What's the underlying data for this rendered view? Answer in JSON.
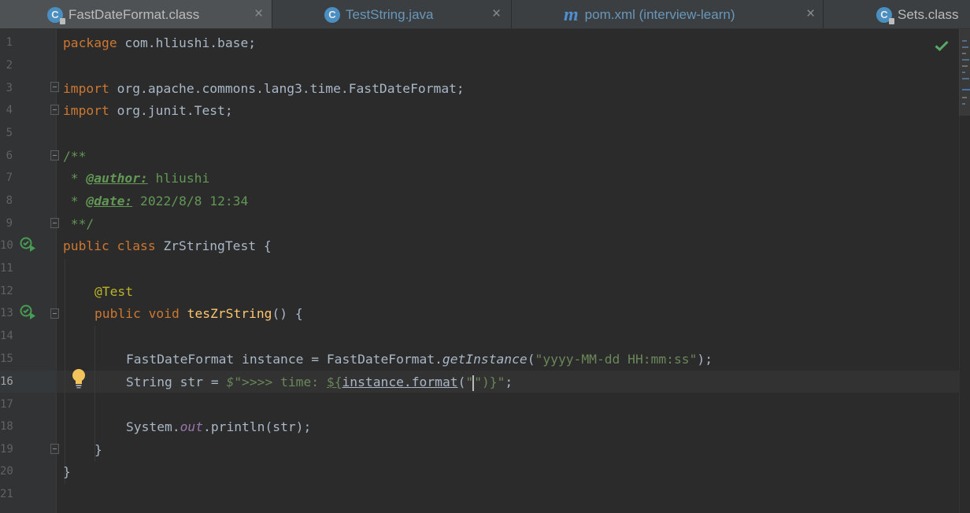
{
  "tabs": [
    {
      "name": "tab-fastdateformat-class",
      "label": "FastDateFormat.class",
      "icon": "class-file-icon",
      "icon_letter": "C",
      "active": true,
      "close": "×"
    },
    {
      "name": "tab-teststring-java",
      "label": "TestString.java",
      "icon": "java-class-icon",
      "icon_letter": "C",
      "active": false,
      "close": "×"
    },
    {
      "name": "tab-pom-xml",
      "label": "pom.xml (interview-learn)",
      "icon": "maven-icon",
      "icon_letter": "m",
      "active": false,
      "close": "×"
    },
    {
      "name": "tab-sets-class",
      "label": "Sets.class",
      "icon": "class-file-icon",
      "icon_letter": "C",
      "active": false,
      "close": ""
    }
  ],
  "colors": {
    "editor_bg": "#2b2b2b",
    "keyword": "#cc7832",
    "string": "#6a8759",
    "doc": "#629755",
    "annotation": "#bbb529",
    "method": "#ffc66d",
    "field": "#9876aa",
    "text": "#a9b7c6",
    "tab_text": "#a9b7c6",
    "tab_text_modified": "#6897bb"
  },
  "editor": {
    "caret_line": 16,
    "line_numbers": [
      "1",
      "2",
      "3",
      "4",
      "5",
      "6",
      "7",
      "8",
      "9",
      "10",
      "11",
      "12",
      "13",
      "14",
      "15",
      "16",
      "17",
      "18",
      "19",
      "20",
      "21"
    ],
    "code": {
      "l1_kw": "package",
      "l1_rest": " com.hliushi.base;",
      "l3_kw": "import",
      "l3_rest": " org.apache.commons.lang3.time.FastDateFormat;",
      "l4_kw": "import",
      "l4_rest": " org.junit.Test;",
      "l6": "/**",
      "l7_star": " * ",
      "l7_tag": "@author:",
      "l7_val": " hliushi",
      "l8_star": " * ",
      "l8_tag": "@date:",
      "l8_val": " 2022/8/8 12:34",
      "l9": " **/",
      "l10_kw": "public class",
      "l10_rest": " ZrStringTest {",
      "l12": "@Test",
      "l13_kw": "public void",
      "l13_sp": " ",
      "l13_meth": "tesZrString",
      "l13_rest": "() {",
      "l15_type": "FastDateFormat instance = FastDateFormat.",
      "l15_meth": "getInstance",
      "l15_open": "(",
      "l15_str": "\"yyyy-MM-dd HH:mm:ss\"",
      "l15_close": ");",
      "l16_a": "String str = ",
      "l16_dollar": "$",
      "l16_str": "\">>>> time: ",
      "l16_tmpl": "${",
      "l16_inst": "instance",
      "l16_dot": ".",
      "l16_fmt": "format",
      "l16_paren": "(",
      "l16_q": "\"",
      "l16_q2": "\")",
      "l16_close": "}\"",
      "l16_semi": ";",
      "l18_a": "System.",
      "l18_out": "out",
      "l18_b": ".println(str);",
      "l19": "}",
      "l20": "}"
    }
  },
  "status": {
    "inspection": "no-problems",
    "check_icon": "checkmark-icon",
    "run_icon": "run-test-icon",
    "bulb_icon": "intention-bulb-icon"
  }
}
